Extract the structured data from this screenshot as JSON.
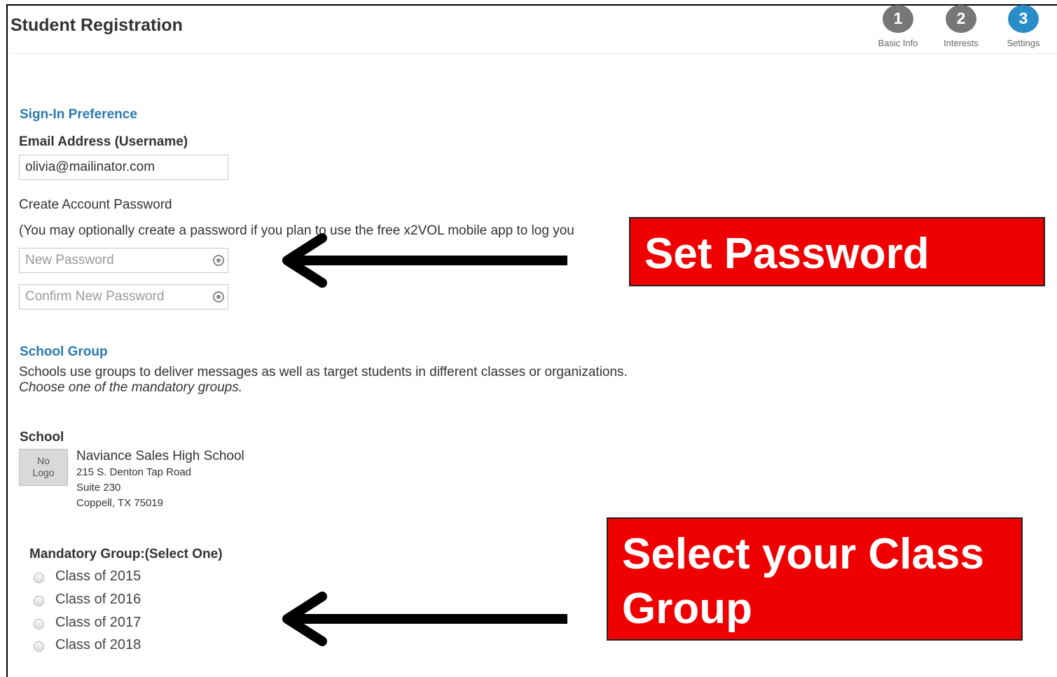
{
  "header": {
    "title": "Student Registration",
    "steps": [
      {
        "number": "1",
        "label": "Basic Info",
        "state": "done",
        "color": "#777777"
      },
      {
        "number": "2",
        "label": "Interests",
        "state": "done",
        "color": "#777777"
      },
      {
        "number": "3",
        "label": "Settings",
        "state": "active",
        "color": "#2a8dc8"
      }
    ]
  },
  "signin": {
    "heading": "Sign-In Preference",
    "email_label": "Email Address (Username)",
    "email_value": "olivia@mailinator.com",
    "password_heading": "Create Account Password",
    "password_note": "(You may optionally create a password if you plan to use the free x2VOL mobile app to log you",
    "new_password_placeholder": "New Password",
    "confirm_password_placeholder": "Confirm New Password"
  },
  "school_group": {
    "heading": "School Group",
    "description": "Schools use groups to deliver messages as well as target students in different classes or organizations.",
    "instruction": "Choose one of the mandatory groups."
  },
  "school": {
    "label": "School",
    "logo_text_line1": "No",
    "logo_text_line2": "Logo",
    "name": "Naviance Sales High School",
    "address_line1": "215 S. Denton Tap Road",
    "address_line2": "Suite 230",
    "address_line3": "Coppell, TX 75019"
  },
  "mandatory_group": {
    "label": "Mandatory Group:(Select One)",
    "options": [
      "Class of 2015",
      "Class of 2016",
      "Class of 2017",
      "Class of 2018"
    ],
    "selected": null
  },
  "annotations": {
    "password_callout": "Set Password",
    "class_callout_line1": "Select your Class",
    "class_callout_line2": "Group",
    "callout_color": "#ee0000",
    "arrow_color": "#000000"
  }
}
